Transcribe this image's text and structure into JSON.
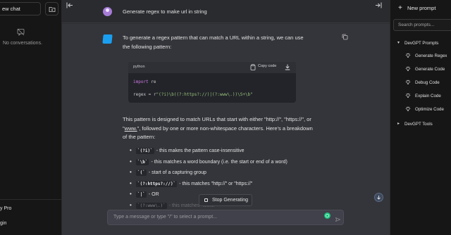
{
  "left_sidebar": {
    "new_chat_label": "ew chat",
    "no_conversations": "No conversations.",
    "pro_label": "y Pro",
    "login_label": "gin"
  },
  "chat": {
    "user_message": "Generate regex to make url in string",
    "intro": "To generate a regex pattern that can match a URL within a string, we can use the following pattern:",
    "code": {
      "language": "python",
      "copy_label": "Copy code",
      "line1_kw": "import",
      "line1_rest": " re",
      "line2_lhs": "regex = r",
      "line2_str": "\"(?i)\\b((?:https?://)|(?:www\\.))\\S+\\b\""
    },
    "description_pre": "This pattern is designed to match URLs that start with either \"http://\", \"https://\", or \"",
    "description_www": "www.",
    "description_post": "\", followed by one or more non-whitespace characters. Here's a breakdown of the pattern:",
    "bullets": [
      {
        "code": "`(?i)`",
        "text": "- this makes the pattern case-insensitive"
      },
      {
        "code": "`\\b`",
        "text": "- this matches a word boundary (i.e. the start or end of a word)"
      },
      {
        "code": "`(`",
        "text": "- start of a capturing group"
      },
      {
        "code": "`(?:https?://)`",
        "text": "- this matches \"http://\" or \"https://\""
      },
      {
        "code": "`|`",
        "text": "- OR"
      },
      {
        "code": "`(?:www\\.)`",
        "text": "- this matches \"www."
      }
    ],
    "stop_label": "Stop Generating",
    "input_placeholder": "Type a message or type \"/\" to select a prompt..."
  },
  "right_sidebar": {
    "new_prompt_label": "New prompt",
    "search_placeholder": "Search prompts...",
    "folders": [
      {
        "name": "DevGPT Prompts",
        "expanded": true
      },
      {
        "name": "DevGPT Tools",
        "expanded": false
      }
    ],
    "prompts": [
      "Generate Regex",
      "Generate Code",
      "Debug Code",
      "Explain Code",
      "Optimize Code"
    ]
  },
  "colors": {
    "accent_green": "#19c37d",
    "user_avatar": "#a67cd6",
    "bot_avatar": "#1a9ff0"
  }
}
